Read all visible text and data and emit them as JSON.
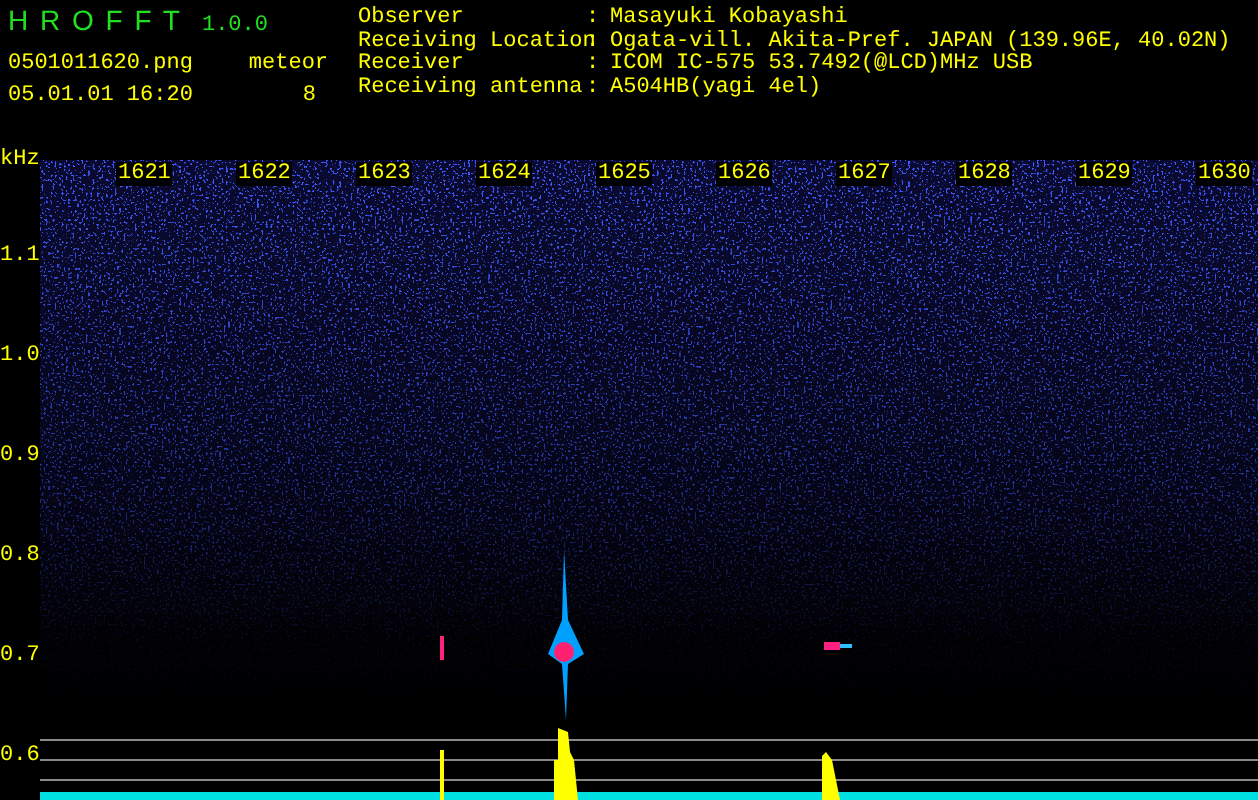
{
  "app": {
    "title": "H R O F F T",
    "version": "1.0.0"
  },
  "file": {
    "name": "0501011620.png",
    "datetime": "05.01.01 16:20"
  },
  "meteor": {
    "label": "meteor",
    "count": "8"
  },
  "station": [
    {
      "label": "Observer",
      "separator": ":",
      "value": "Masayuki Kobayashi"
    },
    {
      "label": "Receiving Location",
      "separator": ":",
      "value": "Ogata-vill. Akita-Pref. JAPAN (139.96E, 40.02N)"
    },
    {
      "label": "Receiver",
      "separator": ":",
      "value": "ICOM IC-575 53.7492(@LCD)MHz USB"
    },
    {
      "label": "Receiving antenna",
      "separator": ":",
      "value": "A504HB(yagi 4el)"
    }
  ],
  "spectrogram": {
    "unit": "kHz",
    "x_labels": [
      "1621",
      "1622",
      "1623",
      "1624",
      "1625",
      "1626",
      "1627",
      "1628",
      "1629",
      "1630"
    ],
    "y_labels": [
      "1.1",
      "1.0",
      "0.9",
      "0.8",
      "0.7",
      "0.6"
    ]
  }
}
